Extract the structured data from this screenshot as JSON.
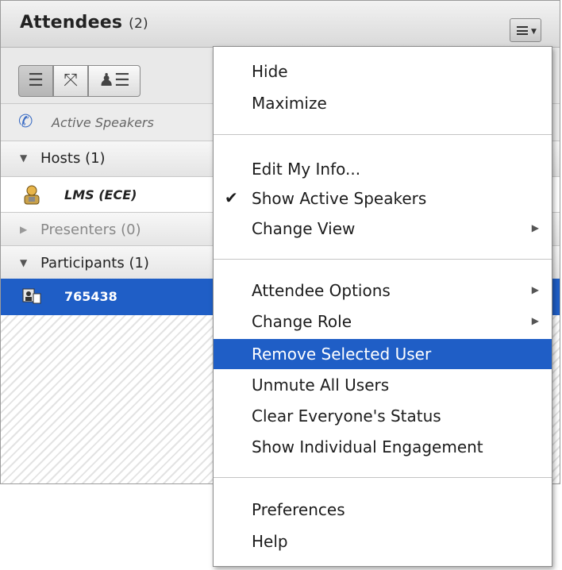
{
  "pod": {
    "title": "Attendees",
    "count": "(2)",
    "active_speakers_label": "Active Speakers",
    "groups": [
      {
        "label": "Hosts (1)",
        "expanded": true
      },
      {
        "label": "Presenters (0)",
        "expanded": false
      },
      {
        "label": "Participants (1)",
        "expanded": true
      }
    ],
    "hosts": [
      {
        "name": "LMS (ECE)"
      }
    ],
    "participants": [
      {
        "name": "765438",
        "selected": true
      }
    ],
    "view_buttons": [
      "list-view",
      "grid-view",
      "role-view"
    ]
  },
  "menu": {
    "items": [
      {
        "label": "Hide"
      },
      {
        "label": "Maximize"
      },
      {
        "label": "Edit My Info..."
      },
      {
        "label": "Show Active Speakers",
        "checked": true
      },
      {
        "label": "Change View",
        "submenu": true
      },
      {
        "label": "Attendee Options",
        "submenu": true
      },
      {
        "label": "Change Role",
        "submenu": true
      },
      {
        "label": "Remove Selected User",
        "highlighted": true
      },
      {
        "label": "Unmute All Users"
      },
      {
        "label": "Clear Everyone's Status"
      },
      {
        "label": "Show Individual Engagement"
      },
      {
        "label": "Preferences"
      },
      {
        "label": "Help"
      }
    ]
  },
  "colors": {
    "selection": "#1f5ec6"
  }
}
